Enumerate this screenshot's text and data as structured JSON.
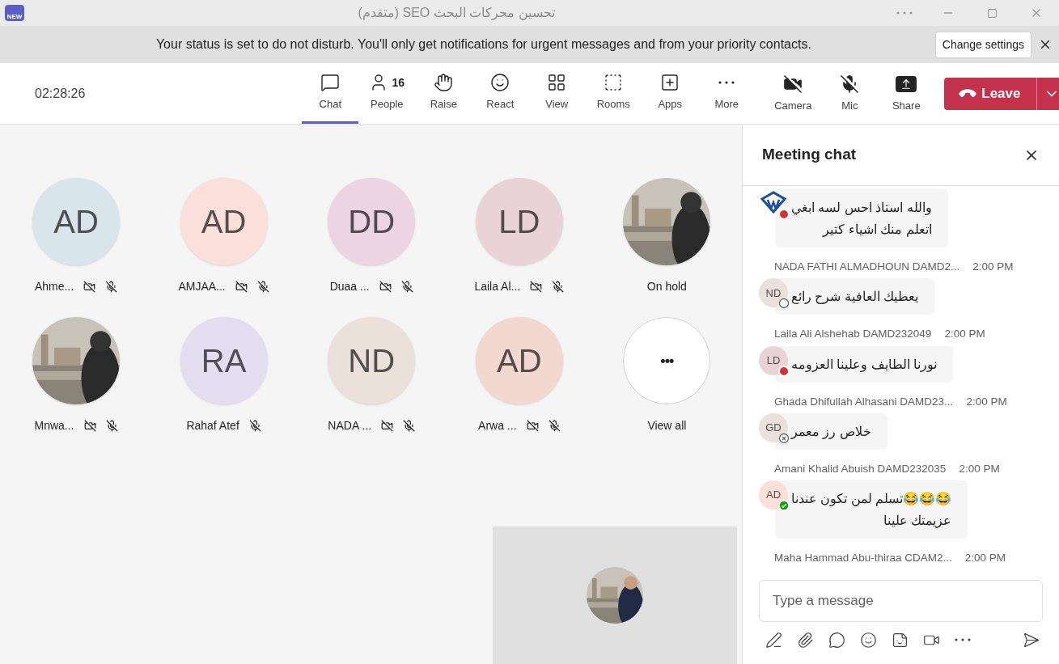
{
  "window": {
    "title": "تحسين محركات البحث SEO (متقدم)",
    "app_badge": "NEW"
  },
  "banner": {
    "text": "Your status is set to do not disturb. You'll only get notifications for urgent messages and from your priority contacts.",
    "button": "Change settings"
  },
  "toolbar": {
    "timer": "02:28:26",
    "items": [
      {
        "kind": "chat",
        "label": "Chat",
        "selected": true
      },
      {
        "kind": "people",
        "label": "People",
        "count": "16",
        "selected": false
      },
      {
        "kind": "raise",
        "label": "Raise",
        "selected": false
      },
      {
        "kind": "react",
        "label": "React",
        "selected": false
      },
      {
        "kind": "view",
        "label": "View",
        "selected": false
      },
      {
        "kind": "rooms",
        "label": "Rooms",
        "selected": false
      },
      {
        "kind": "apps",
        "label": "Apps",
        "selected": false
      },
      {
        "kind": "more",
        "label": "More",
        "selected": false
      }
    ],
    "devices": [
      {
        "kind": "camera",
        "label": "Camera",
        "on": false
      },
      {
        "kind": "mic",
        "label": "Mic",
        "on": false
      },
      {
        "kind": "share",
        "label": "Share",
        "on": false
      }
    ],
    "leave": "Leave"
  },
  "participants": [
    {
      "kind": "initials",
      "initials": "AD",
      "name": "Ahme...",
      "color": "#d8e5ea",
      "camera_off": true,
      "muted": true
    },
    {
      "kind": "initials",
      "initials": "AD",
      "name": "AMJAA...",
      "color": "#fbdfd9",
      "camera_off": true,
      "muted": true
    },
    {
      "kind": "initials",
      "initials": "DD",
      "name": "Duaa ...",
      "color": "#ecd4e3",
      "camera_off": true,
      "muted": true
    },
    {
      "kind": "initials",
      "initials": "LD",
      "name": "Laila Al...",
      "color": "#ead3d6",
      "camera_off": true,
      "muted": true
    },
    {
      "kind": "picture",
      "name": "On hold",
      "camera_off": false,
      "muted": false
    },
    {
      "kind": "picture",
      "name": "Mnwa...",
      "camera_off": true,
      "muted": true
    },
    {
      "kind": "initials",
      "initials": "RA",
      "name": "Rahaf Atef",
      "color": "#e2deef",
      "camera_off": false,
      "muted": true
    },
    {
      "kind": "initials",
      "initials": "ND",
      "name": "NADA ...",
      "color": "#ebe0da",
      "camera_off": true,
      "muted": true
    },
    {
      "kind": "initials",
      "initials": "AD",
      "name": "Arwa ...",
      "color": "#f3d8d0",
      "camera_off": true,
      "muted": true
    },
    {
      "kind": "more",
      "symbol": "•••",
      "name": "View all",
      "camera_off": false,
      "muted": false
    }
  ],
  "chat": {
    "title": "Meeting chat",
    "messages": [
      {
        "avatar": {
          "kind": "logo"
        },
        "status": {
          "kind": "busy"
        },
        "lines": [
          "والله استاذ احس لسه ابغي",
          "اتعلم منك اشياء كتير"
        ]
      },
      {
        "sender": "NADA FATHI ALMADHOUN DAMD2...",
        "time": "2:00 PM",
        "avatar": {
          "kind": "initials",
          "initials": "ND",
          "color": "#ebe0da"
        },
        "status": {
          "kind": "offline"
        },
        "lines": [
          "يعطيك العافية شرح رائع"
        ]
      },
      {
        "sender": "Laila Ali Alshehab DAMD232049",
        "time": "2:00 PM",
        "avatar": {
          "kind": "initials",
          "initials": "LD",
          "color": "#ead3d6"
        },
        "status": {
          "kind": "busy"
        },
        "lines": [
          "نورنا الطايف وعلينا العزومه"
        ]
      },
      {
        "sender": "Ghada Dhifullah Alhasani DAMD23...",
        "time": "2:00 PM",
        "avatar": {
          "kind": "initials",
          "initials": "GD",
          "color": "#ebe0da"
        },
        "status": {
          "kind": "blocked"
        },
        "lines": [
          "خلاص رز معمر"
        ]
      },
      {
        "sender": "Amani Khalid Abuish DAMD232035",
        "time": "2:00 PM",
        "avatar": {
          "kind": "initials",
          "initials": "AD",
          "color": "#fbdfd9"
        },
        "status": {
          "kind": "available"
        },
        "lines": [
          "😂😂😂تسلم لمن تكون عندنا",
          "عزيمتك علينا"
        ]
      },
      {
        "sender": "Maha Hammad Abu-thiraa CDAM2...",
        "time": "2:00 PM"
      }
    ],
    "input": {
      "placeholder": "Type a message"
    }
  }
}
